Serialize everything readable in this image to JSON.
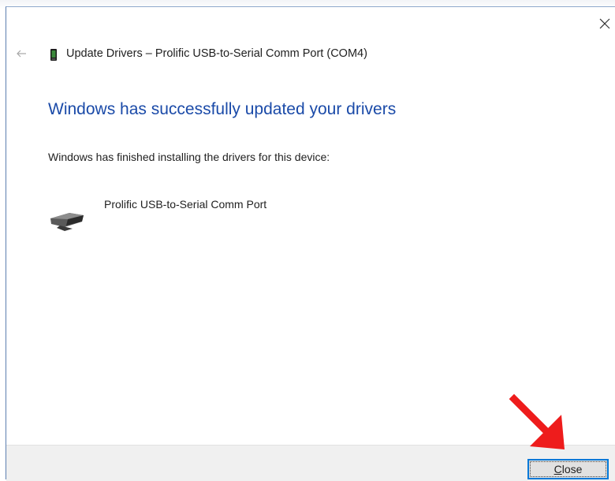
{
  "window": {
    "title": "Update Drivers – Prolific USB-to-Serial Comm Port (COM4)"
  },
  "content": {
    "heading": "Windows has successfully updated your drivers",
    "body": "Windows has finished installing the drivers for this device:",
    "device_name": "Prolific USB-to-Serial Comm Port"
  },
  "footer": {
    "close_button": {
      "accelerator": "C",
      "rest": "lose"
    }
  },
  "icons": {
    "back": "back-arrow-icon",
    "close": "close-icon",
    "device_small": "usb-device-icon",
    "device_large": "serial-port-device-icon",
    "annotation": "red-arrow-icon"
  },
  "colors": {
    "heading": "#1a4aa8",
    "button_focus": "#0078d7",
    "annotation_arrow": "#ee1c1c",
    "footer_bg": "#f0f0f0"
  }
}
